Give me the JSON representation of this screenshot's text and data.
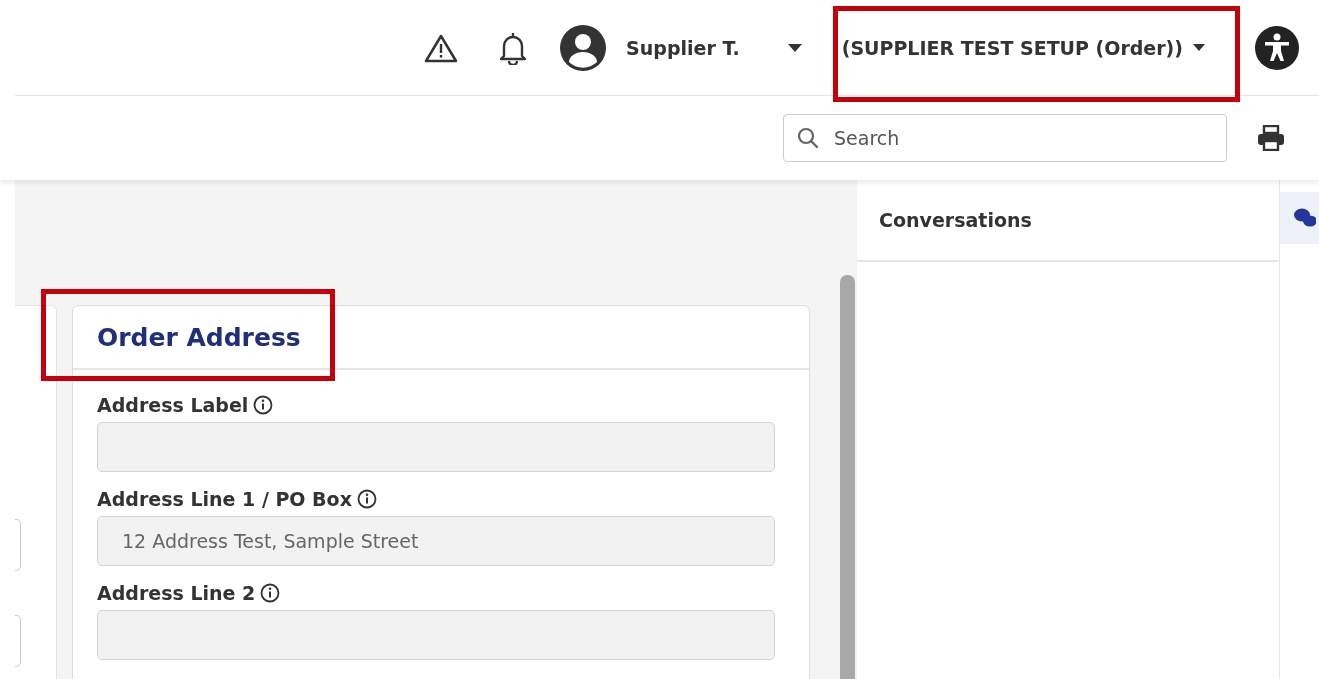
{
  "header": {
    "user": {
      "name": "Supplier T."
    },
    "account": {
      "label": "(SUPPLIER TEST SETUP (Order))"
    }
  },
  "search": {
    "placeholder": "Search"
  },
  "card": {
    "title": "Order Address",
    "fields": [
      {
        "label": "Address Label"
      },
      {
        "label": "Address Line 1 / PO Box",
        "value": "12 Address Test, Sample Street"
      },
      {
        "label": "Address Line 2"
      }
    ]
  },
  "conversations": {
    "title": "Conversations"
  }
}
